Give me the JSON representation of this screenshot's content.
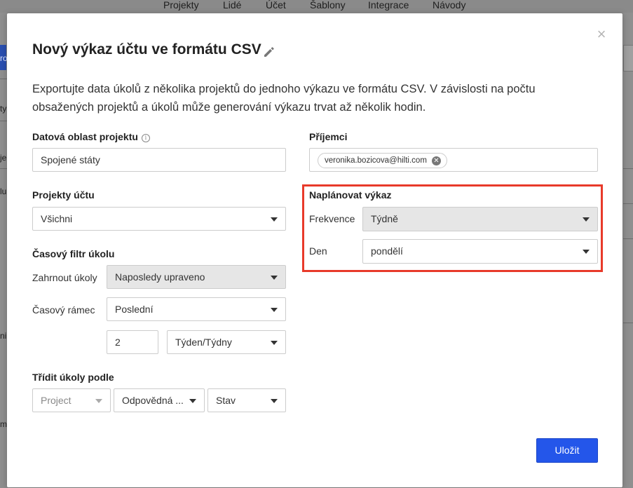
{
  "background": {
    "nav_items": [
      "Projekty",
      "Lidé",
      "Účet",
      "Šablony",
      "Integrace",
      "Návody"
    ],
    "fragments": [
      "ro",
      "ty",
      "je",
      "lu",
      "ni",
      "m"
    ]
  },
  "modal": {
    "title": "Nový výkaz účtu ve formátu CSV",
    "description": "Exportujte data úkolů z několika projektů do jednoho výkazu ve formátu CSV. V závislosti na počtu obsažených projektů a úkolů může generování výkazu trvat až několik hodin.",
    "data_region": {
      "label": "Datová oblast projektu",
      "info_glyph": "i",
      "value": "Spojené státy"
    },
    "recipients": {
      "label": "Příjemci",
      "chips": [
        "veronika.bozicova@hilti.com"
      ]
    },
    "account_projects": {
      "label": "Projekty účtu",
      "value": "Všichni"
    },
    "schedule": {
      "label": "Naplánovat výkaz",
      "frequency_label": "Frekvence",
      "frequency_value": "Týdně",
      "day_label": "Den",
      "day_value": "pondělí"
    },
    "time_filter": {
      "label": "Časový filtr úkolu",
      "include_label": "Zahrnout úkoly",
      "include_value": "Naposledy upraveno",
      "timeframe_label": "Časový rámec",
      "timeframe_value": "Poslední",
      "amount_value": "2",
      "unit_value": "Týden/Týdny"
    },
    "sort": {
      "label": "Třídit úkoly podle",
      "first": "Project",
      "second": "Odpovědná ...",
      "third": "Stav"
    },
    "save_label": "Uložit",
    "close_glyph": "×"
  },
  "colors": {
    "accent": "#2456ea",
    "highlight": "#e83a2a"
  }
}
